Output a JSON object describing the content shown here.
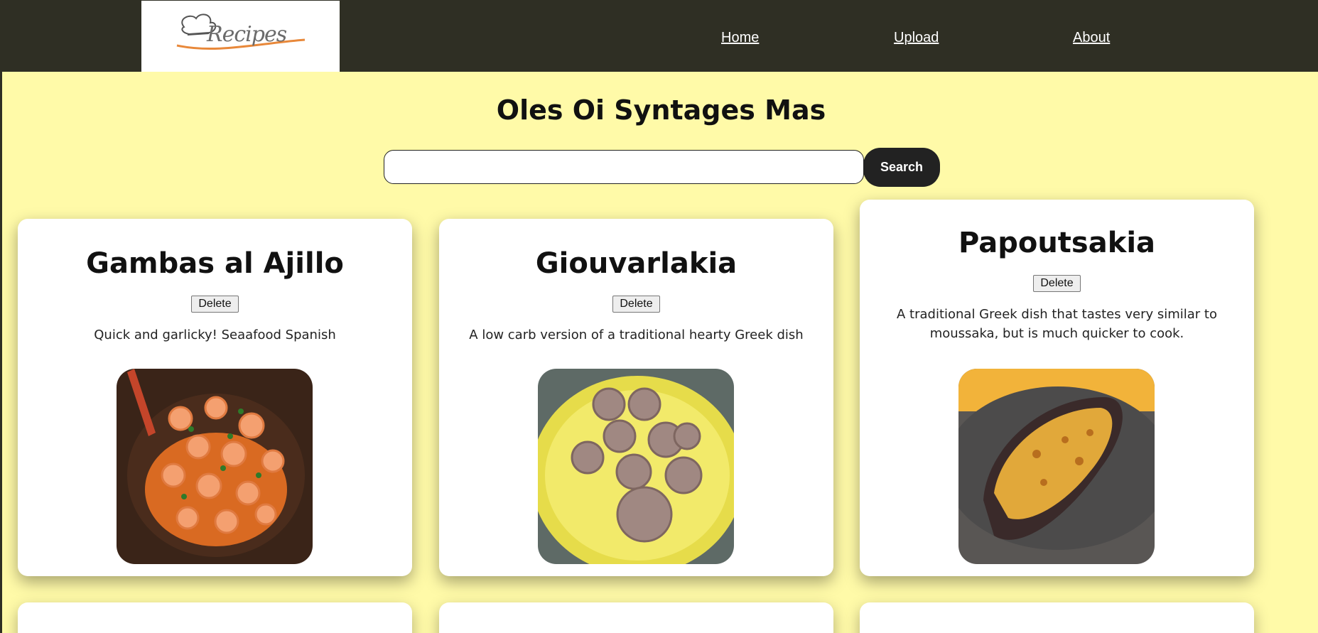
{
  "header": {
    "logo_text": "Recipes",
    "nav": [
      "Home",
      "Upload",
      "About"
    ]
  },
  "page": {
    "title": "Oles Oi Syntages Mas"
  },
  "search": {
    "value": "",
    "placeholder": "",
    "button_label": "Search"
  },
  "recipes": [
    {
      "title": "Gambas al Ajillo",
      "delete_label": "Delete",
      "description": "Quick and garlicky! Seaafood Spanish",
      "image_icon": "shrimp-dish-photo"
    },
    {
      "title": "Giouvarlakia",
      "delete_label": "Delete",
      "description": "A low carb version of a traditional hearty Greek dish",
      "image_icon": "meatball-soup-photo"
    },
    {
      "title": "Papoutsakia",
      "delete_label": "Delete",
      "description": "A traditional Greek dish that tastes very similar to moussaka, but is much quicker to cook.",
      "image_icon": "stuffed-eggplant-photo"
    }
  ],
  "colors": {
    "background": "#fffaa8",
    "header": "#2f2f24",
    "search_button": "#222222"
  }
}
